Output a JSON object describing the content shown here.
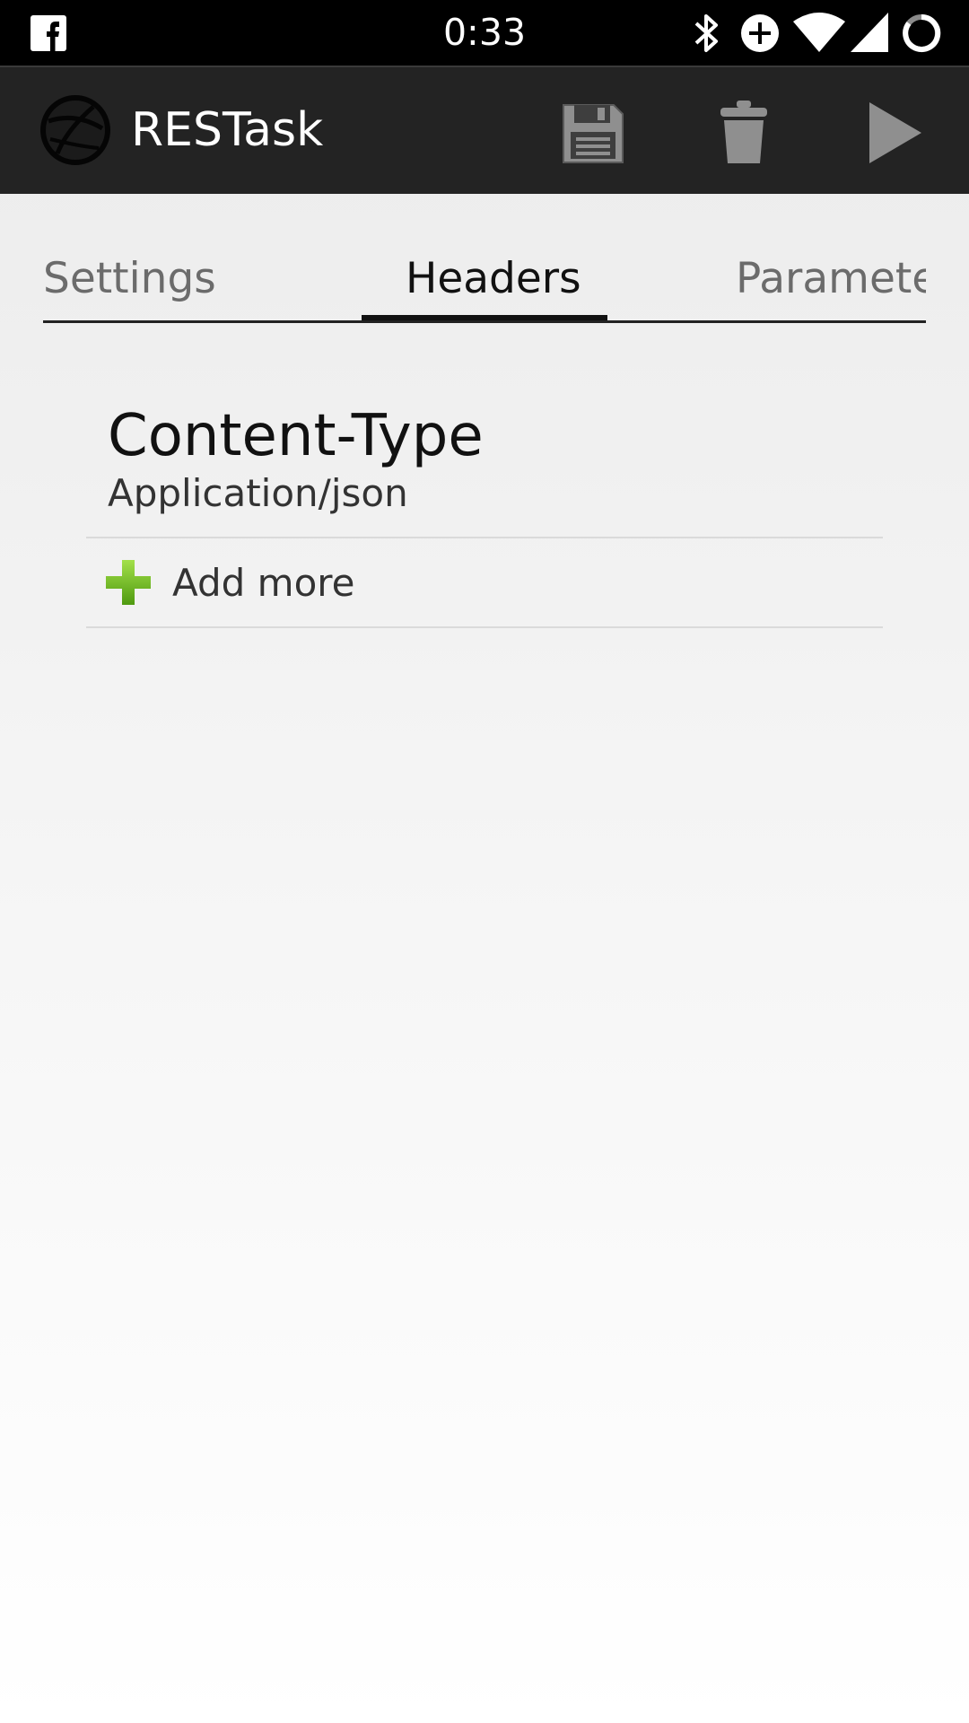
{
  "status_bar": {
    "time": "0:33",
    "icons": [
      "facebook-icon",
      "bluetooth-icon",
      "data-saver-icon",
      "wifi-icon",
      "signal-icon",
      "battery-ring-icon"
    ]
  },
  "action_bar": {
    "title": "RESTask",
    "logo_icon": "globe-logo-icon",
    "actions": [
      "save-icon",
      "trash-icon",
      "play-icon"
    ]
  },
  "tabs": {
    "items": [
      "Settings",
      "Headers",
      "Parameter"
    ],
    "selected": "Headers"
  },
  "headers": [
    {
      "name": "Content-Type",
      "value": "Application/json"
    }
  ],
  "add_more": {
    "label": "Add more",
    "icon": "plus-icon",
    "icon_color": "#6bb51b"
  },
  "colors": {
    "status_bar": "#000000",
    "action_bar": "#232323",
    "tab_indicator": "#111111"
  }
}
